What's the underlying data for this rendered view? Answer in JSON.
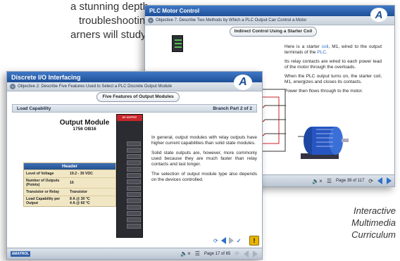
{
  "marketing": {
    "lines": [
      "a stunning depth",
      "troubleshooting",
      "arners will study"
    ],
    "caption": [
      "Interactive",
      "Multimedia",
      "Curriculum"
    ]
  },
  "back_window": {
    "title": "PLC Motor Control",
    "objective": "Objective 7: Describe Two Methods by Which a PLC Output Can Control a Motor",
    "section": "Indirect Control Using a Starter Coil",
    "paragraph1_parts": [
      "Here is a starter ",
      "coil",
      ", M1, wired to the output terminals of the ",
      "PLC",
      "."
    ],
    "paragraph2": "Its relay contacts are wired to each power lead of the motor through the overloads.",
    "paragraph3": "When the PLC output turns on, the starter coil, M1, energizes and closes its contacts.",
    "paragraph4": "Power then flows through to the motor.",
    "page_label": "Page 39 of 117"
  },
  "front_window": {
    "title": "Discrete I/O Interfacing",
    "objective": "Objective 2: Describe Five Features Used to Select a PLC Discrete Output Module",
    "section": "Five Features of Output Modules",
    "left_heading": "Load Capability",
    "branch": "Branch Part 2 of 2",
    "module_title": "Output Module",
    "module_model": "1756 OB16",
    "module_label": "DC OUTPUT",
    "table": {
      "header": "Header",
      "rows": [
        {
          "k": "Level of Voltage",
          "v": "19.2 - 30 VDC"
        },
        {
          "k": "Number of Outputs (Points)",
          "v": "16"
        },
        {
          "k": "Transistor or Relay",
          "v": "Transistor"
        },
        {
          "k": "Load Capability per Output",
          "v": "8 A @ 30 °C\n4 A @ 60 °C"
        }
      ]
    },
    "p1": "In general, output modules with relay outputs have higher current capabilities than solid state modules.",
    "p2": "Solid state outputs are, however, more commonly used because they are much faster than relay contacts and last longer.",
    "p3": "The selection of output module type also depends on the devices controlled.",
    "page_label": "Page 17 of 65",
    "brand": "AMATROL"
  },
  "logo_text": "A",
  "colors": {
    "title_blue": "#1f4f98",
    "accent_blue": "#2d6fc9",
    "warn": "#e9b500"
  }
}
